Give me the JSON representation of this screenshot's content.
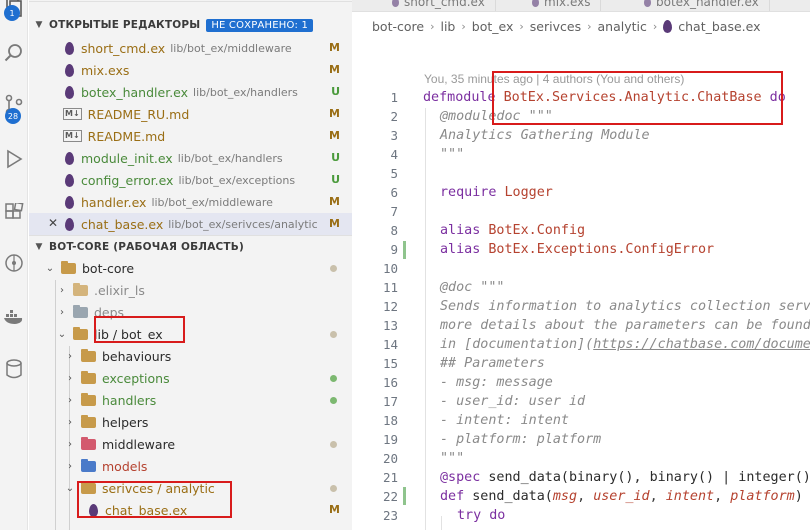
{
  "activity_bar": {
    "badges": [
      "1",
      "28"
    ],
    "icons": [
      "files-icon",
      "search-icon",
      "source-control-icon",
      "run-debug-icon",
      "extensions-icon",
      "git-graph-icon",
      "docker-icon",
      "database-icon"
    ]
  },
  "sidebar": {
    "open_editors": {
      "title": "ОТКРЫТЫЕ РЕДАКТОРЫ",
      "unsaved_badge": "НЕ СОХРАНЕНО: 1",
      "items": [
        {
          "name": "short_cmd.ex",
          "path": "lib/bot_ex/middleware",
          "status": "M",
          "icon": "elixir-drop-icon"
        },
        {
          "name": "mix.exs",
          "path": "",
          "status": "M",
          "icon": "elixir-drop-icon"
        },
        {
          "name": "botex_handler.ex",
          "path": "lib/bot_ex/handlers",
          "status": "U",
          "icon": "elixir-drop-icon"
        },
        {
          "name": "README_RU.md",
          "path": "",
          "status": "M",
          "icon": "markdown-icon"
        },
        {
          "name": "README.md",
          "path": "",
          "status": "M",
          "icon": "markdown-icon"
        },
        {
          "name": "module_init.ex",
          "path": "lib/bot_ex/handlers",
          "status": "U",
          "icon": "elixir-drop-icon"
        },
        {
          "name": "config_error.ex",
          "path": "lib/bot_ex/exceptions",
          "status": "U",
          "icon": "elixir-drop-icon"
        },
        {
          "name": "handler.ex",
          "path": "lib/bot_ex/middleware",
          "status": "M",
          "icon": "elixir-drop-icon"
        },
        {
          "name": "chat_base.ex",
          "path": "lib/bot_ex/serivces/analytic",
          "status": "M",
          "icon": "elixir-drop-icon",
          "selected": true
        }
      ]
    },
    "workspace": {
      "title": "BOT-CORE (РАБОЧАЯ ОБЛАСТЬ)",
      "root": "bot-core",
      "items": [
        {
          "name": ".elixir_ls",
          "kind": "folder"
        },
        {
          "name": "deps",
          "kind": "folder"
        },
        {
          "name": "lib / bot_ex",
          "kind": "folder",
          "open": true
        },
        {
          "name": "behaviours",
          "kind": "folder"
        },
        {
          "name": "exceptions",
          "kind": "folder"
        },
        {
          "name": "handlers",
          "kind": "folder"
        },
        {
          "name": "helpers",
          "kind": "folder"
        },
        {
          "name": "middleware",
          "kind": "folder"
        },
        {
          "name": "models",
          "kind": "folder"
        },
        {
          "name": "serivces / analytic",
          "kind": "folder",
          "open": true
        },
        {
          "name": "chat_base.ex",
          "kind": "file",
          "status": "M"
        }
      ]
    }
  },
  "tabs": [
    {
      "label": "short_cmd.ex"
    },
    {
      "label": "mix.exs"
    },
    {
      "label": "botex_handler.ex"
    }
  ],
  "breadcrumb": [
    "bot-core",
    "lib",
    "bot_ex",
    "serivces",
    "analytic",
    "chat_base.ex"
  ],
  "editor": {
    "blame": "You, 35 minutes ago | 4 authors (You and others)",
    "line_numbers": [
      "1",
      "2",
      "3",
      "4",
      "5",
      "6",
      "7",
      "8",
      "9",
      "10",
      "11",
      "12",
      "13",
      "14",
      "15",
      "16",
      "17",
      "18",
      "19",
      "20",
      "21",
      "22",
      "23"
    ]
  }
}
